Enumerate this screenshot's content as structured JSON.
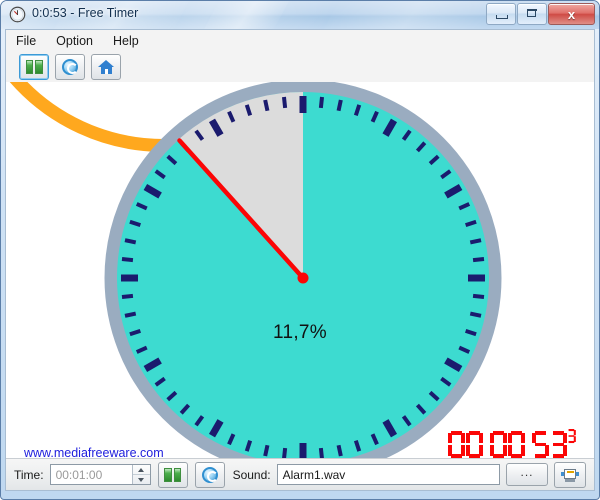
{
  "window": {
    "title": "0:0:53 - Free Timer",
    "icon": "clock-icon",
    "controls": {
      "minimize": "minimize",
      "maximize": "maximize",
      "close": "x"
    }
  },
  "menu": {
    "items": [
      {
        "label": "File"
      },
      {
        "label": "Option"
      },
      {
        "label": "Help"
      }
    ]
  },
  "toolbar": {
    "buttons": [
      {
        "name": "pause-button",
        "icon": "pause-icon",
        "active": true
      },
      {
        "name": "reset-button",
        "icon": "reset-icon",
        "active": false
      },
      {
        "name": "home-button",
        "icon": "home-icon",
        "active": false
      }
    ]
  },
  "clock": {
    "percent_label": "11,7%",
    "percent_value": 11.7,
    "hand_angle_deg": -42,
    "colors": {
      "face": "#3ddbd0",
      "elapsed_wedge": "#dcdcdc",
      "outer_ring": "#9aacc0",
      "progress_arc": "#ffa81e",
      "tick": "#1b1b6e",
      "hand": "#fb0606"
    },
    "ticks_total": 60,
    "major_tick_every": 5
  },
  "readout": {
    "hours": "00",
    "minutes": "00",
    "seconds": "53",
    "tenths": "3",
    "color": "#fb0606"
  },
  "link": {
    "label": "www.mediafreeware.com"
  },
  "statusbar": {
    "time_label": "Time:",
    "time_value": "00:01:00",
    "sound_label": "Sound:",
    "sound_value": "Alarm1.wav",
    "browse_label": "...",
    "pause_icon": "pause-icon",
    "reset_icon": "reset-icon",
    "monitor_icon": "monitor-icon"
  }
}
